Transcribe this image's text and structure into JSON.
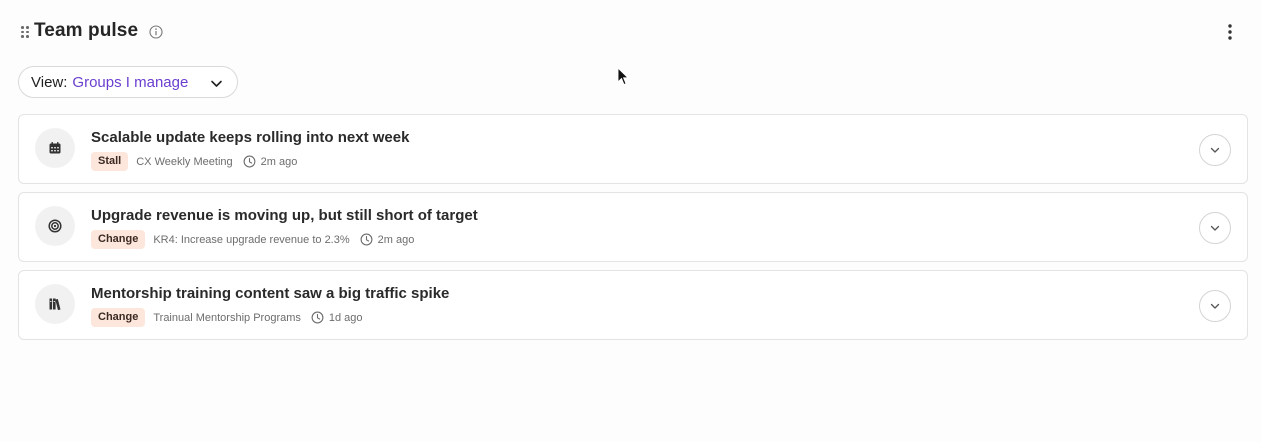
{
  "widget": {
    "title": "Team pulse",
    "info_icon": "info-icon",
    "menu_icon": "more-vertical-icon"
  },
  "view": {
    "prefix": "View:",
    "value": "Groups I manage",
    "accent_color": "#6a3fd0"
  },
  "items": [
    {
      "title": "Scalable update keeps rolling into next week",
      "badge": "Stall",
      "source": "CX Weekly Meeting",
      "time": "2m ago",
      "icon": "calendar-icon"
    },
    {
      "title": "Upgrade revenue is moving up, but still short of target",
      "badge": "Change",
      "source": "KR4: Increase upgrade revenue to 2.3%",
      "time": "2m ago",
      "icon": "target-icon"
    },
    {
      "title": "Mentorship training content saw a big traffic spike",
      "badge": "Change",
      "source": "Trainual Mentorship Programs",
      "time": "1d ago",
      "icon": "books-icon"
    }
  ],
  "colors": {
    "badge_bg": "#fde6dc",
    "card_border": "#e3e3e3"
  }
}
